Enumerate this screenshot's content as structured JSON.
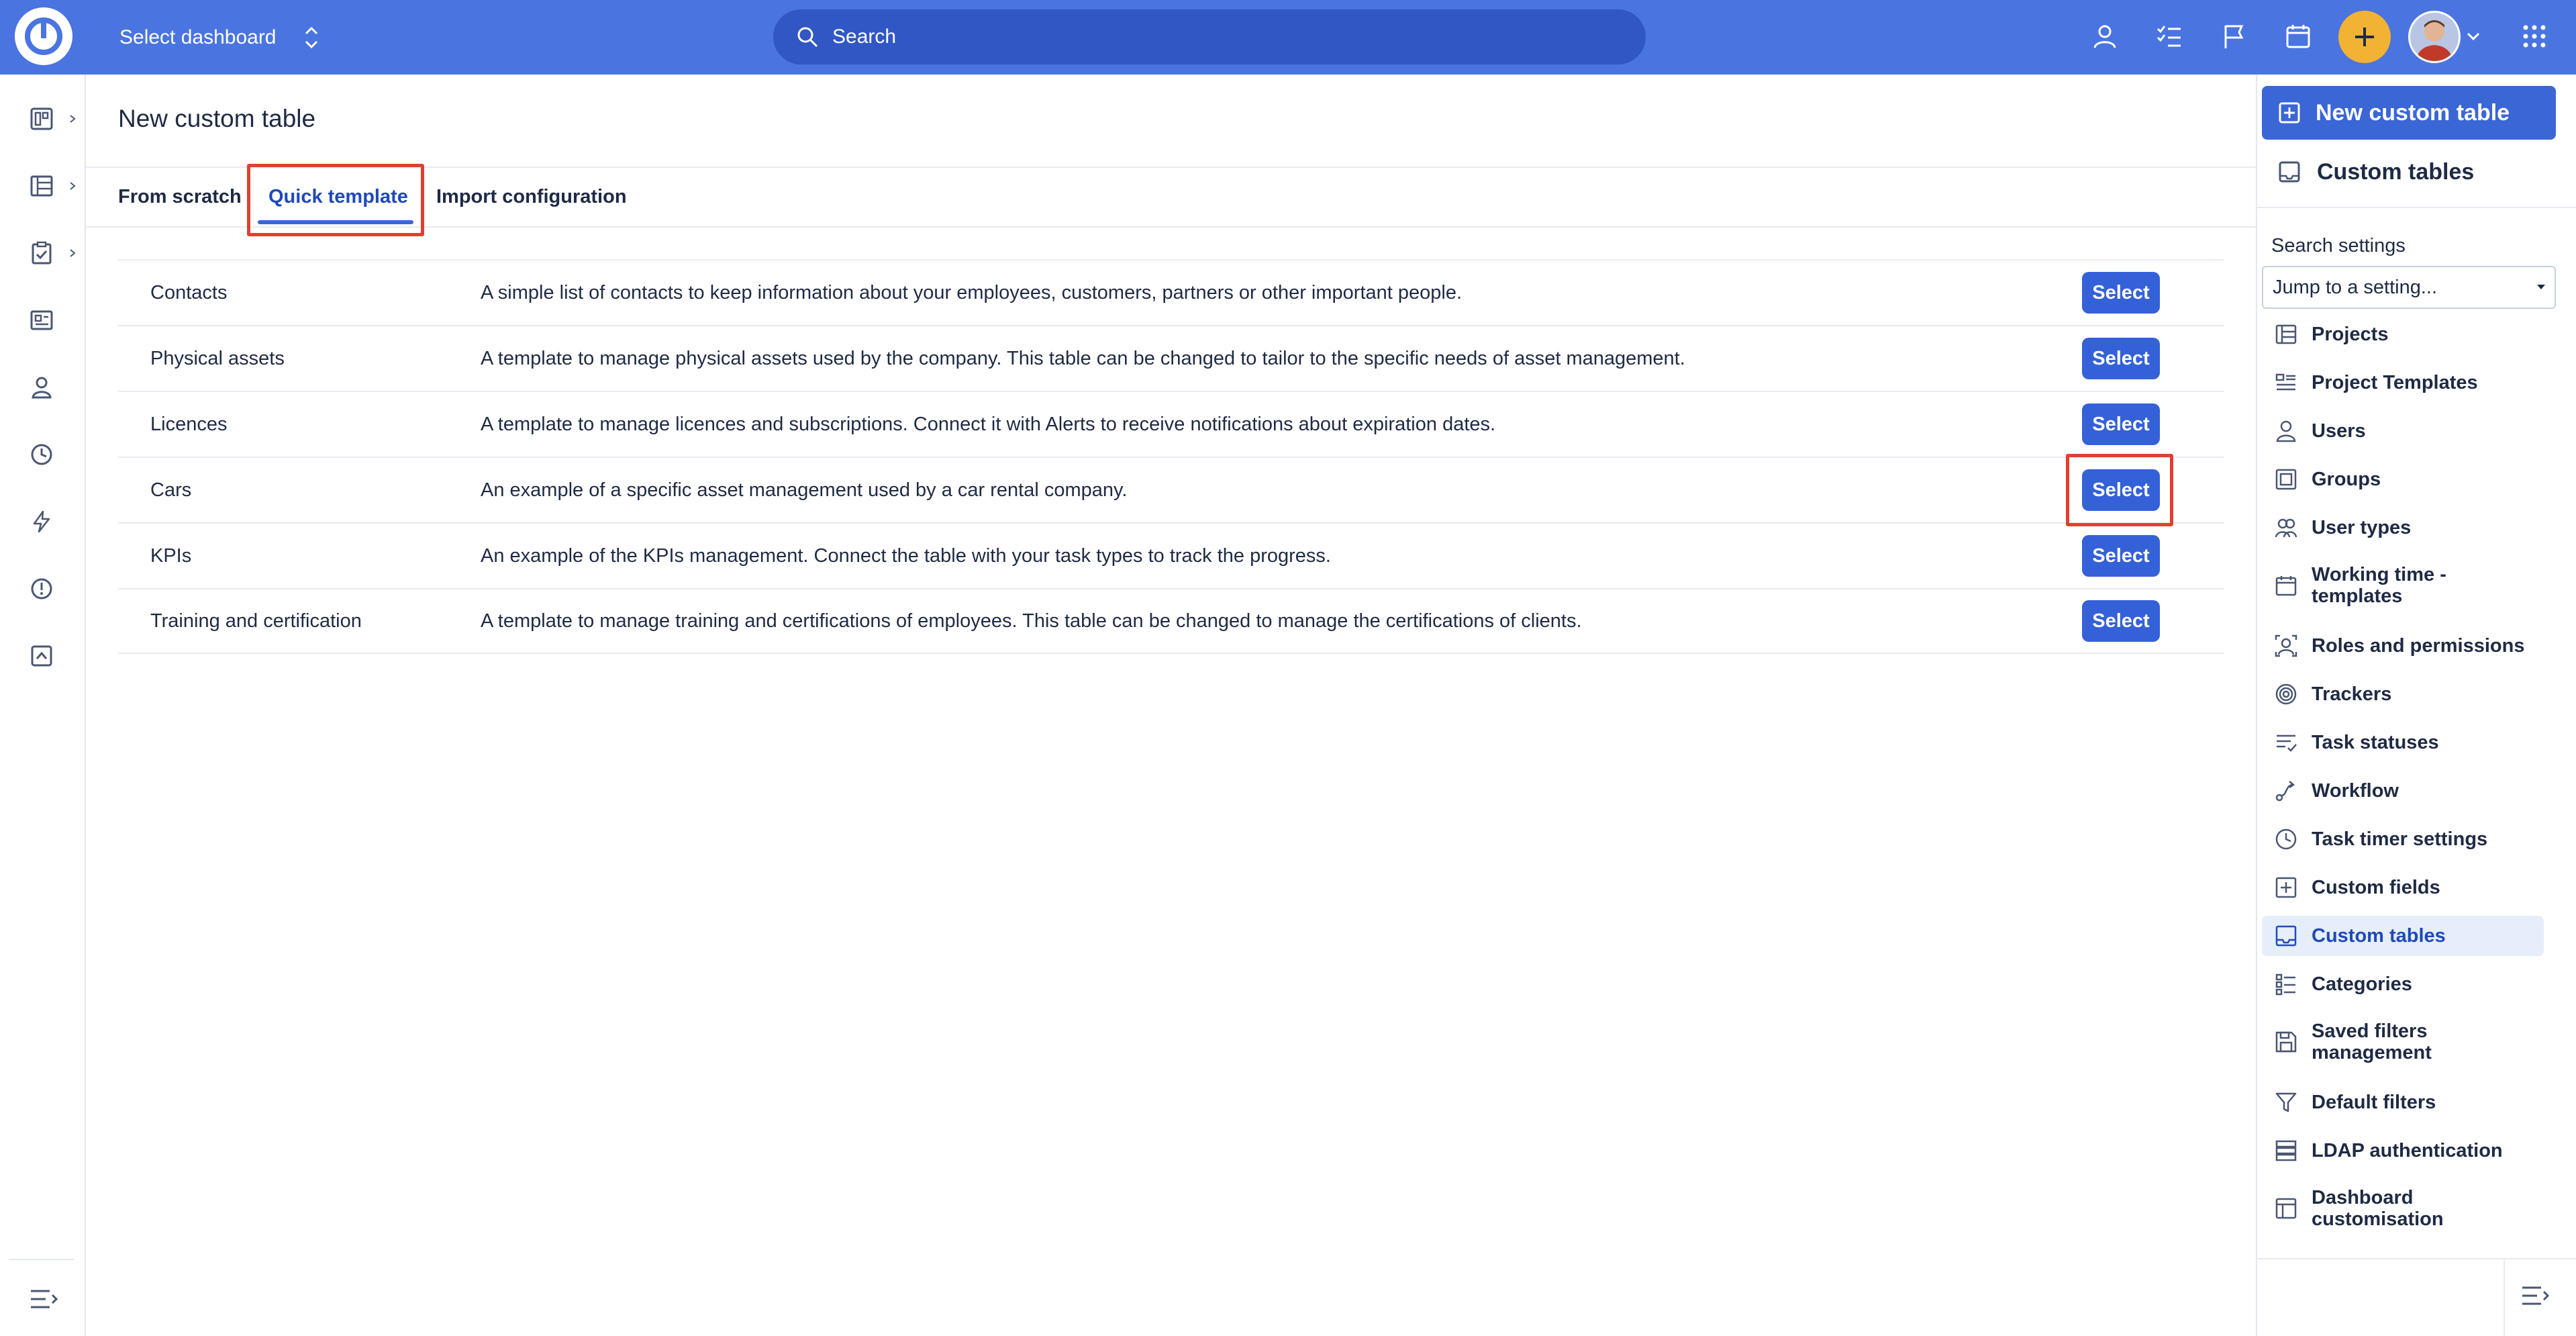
{
  "topbar": {
    "dashboard_label": "Select dashboard",
    "search_placeholder": "Search"
  },
  "page": {
    "title": "New custom table",
    "tabs": [
      {
        "label": "From scratch"
      },
      {
        "label": "Quick template"
      },
      {
        "label": "Import configuration"
      }
    ],
    "active_tab": "Quick template"
  },
  "templates": [
    {
      "name": "Contacts",
      "description": "A simple list of contacts to keep information about your employees, customers, partners or other important people.",
      "button": "Select"
    },
    {
      "name": "Physical assets",
      "description": "A template to manage physical assets used by the company. This table can be changed to tailor to the specific needs of asset management.",
      "button": "Select"
    },
    {
      "name": "Licences",
      "description": "A template to manage licences and subscriptions. Connect it with Alerts to receive notifications about expiration dates.",
      "button": "Select"
    },
    {
      "name": "Cars",
      "description": "An example of a specific asset management used by a car rental company.",
      "button": "Select"
    },
    {
      "name": "KPIs",
      "description": "An example of the KPIs management. Connect the table with your task types to track the progress.",
      "button": "Select"
    },
    {
      "name": "Training and certification",
      "description": "A template to manage training and certifications of employees. This table can be changed to manage the certifications of clients.",
      "button": "Select"
    }
  ],
  "sidebar": {
    "new_button": "New custom table",
    "custom_tables_link": "Custom tables",
    "search_settings_label": "Search settings",
    "jump_placeholder": "Jump to a setting...",
    "items": [
      {
        "label": "Projects",
        "icon": "projects-icon"
      },
      {
        "label": "Project Templates",
        "icon": "project-templates-icon"
      },
      {
        "label": "Users",
        "icon": "user-icon"
      },
      {
        "label": "Groups",
        "icon": "groups-icon"
      },
      {
        "label": "User types",
        "icon": "user-types-icon"
      },
      {
        "label": "Working time - templates",
        "icon": "calendar-icon"
      },
      {
        "label": "Roles and permissions",
        "icon": "roles-icon"
      },
      {
        "label": "Trackers",
        "icon": "target-icon"
      },
      {
        "label": "Task statuses",
        "icon": "task-statuses-icon"
      },
      {
        "label": "Workflow",
        "icon": "workflow-icon"
      },
      {
        "label": "Task timer settings",
        "icon": "clock-icon"
      },
      {
        "label": "Custom fields",
        "icon": "plus-square-icon"
      },
      {
        "label": "Custom tables",
        "icon": "table-icon",
        "active": true
      },
      {
        "label": "Categories",
        "icon": "categories-icon"
      },
      {
        "label": "Saved filters management",
        "icon": "save-icon"
      },
      {
        "label": "Default filters",
        "icon": "filter-icon"
      },
      {
        "label": "LDAP authentication",
        "icon": "server-icon"
      },
      {
        "label": "Dashboard customisation",
        "icon": "dashboard-icon"
      }
    ]
  },
  "colors": {
    "topbar": "#4a74e0",
    "primary_button": "#3461d8",
    "highlight": "#e0402f",
    "plus_button": "#f2b233"
  }
}
